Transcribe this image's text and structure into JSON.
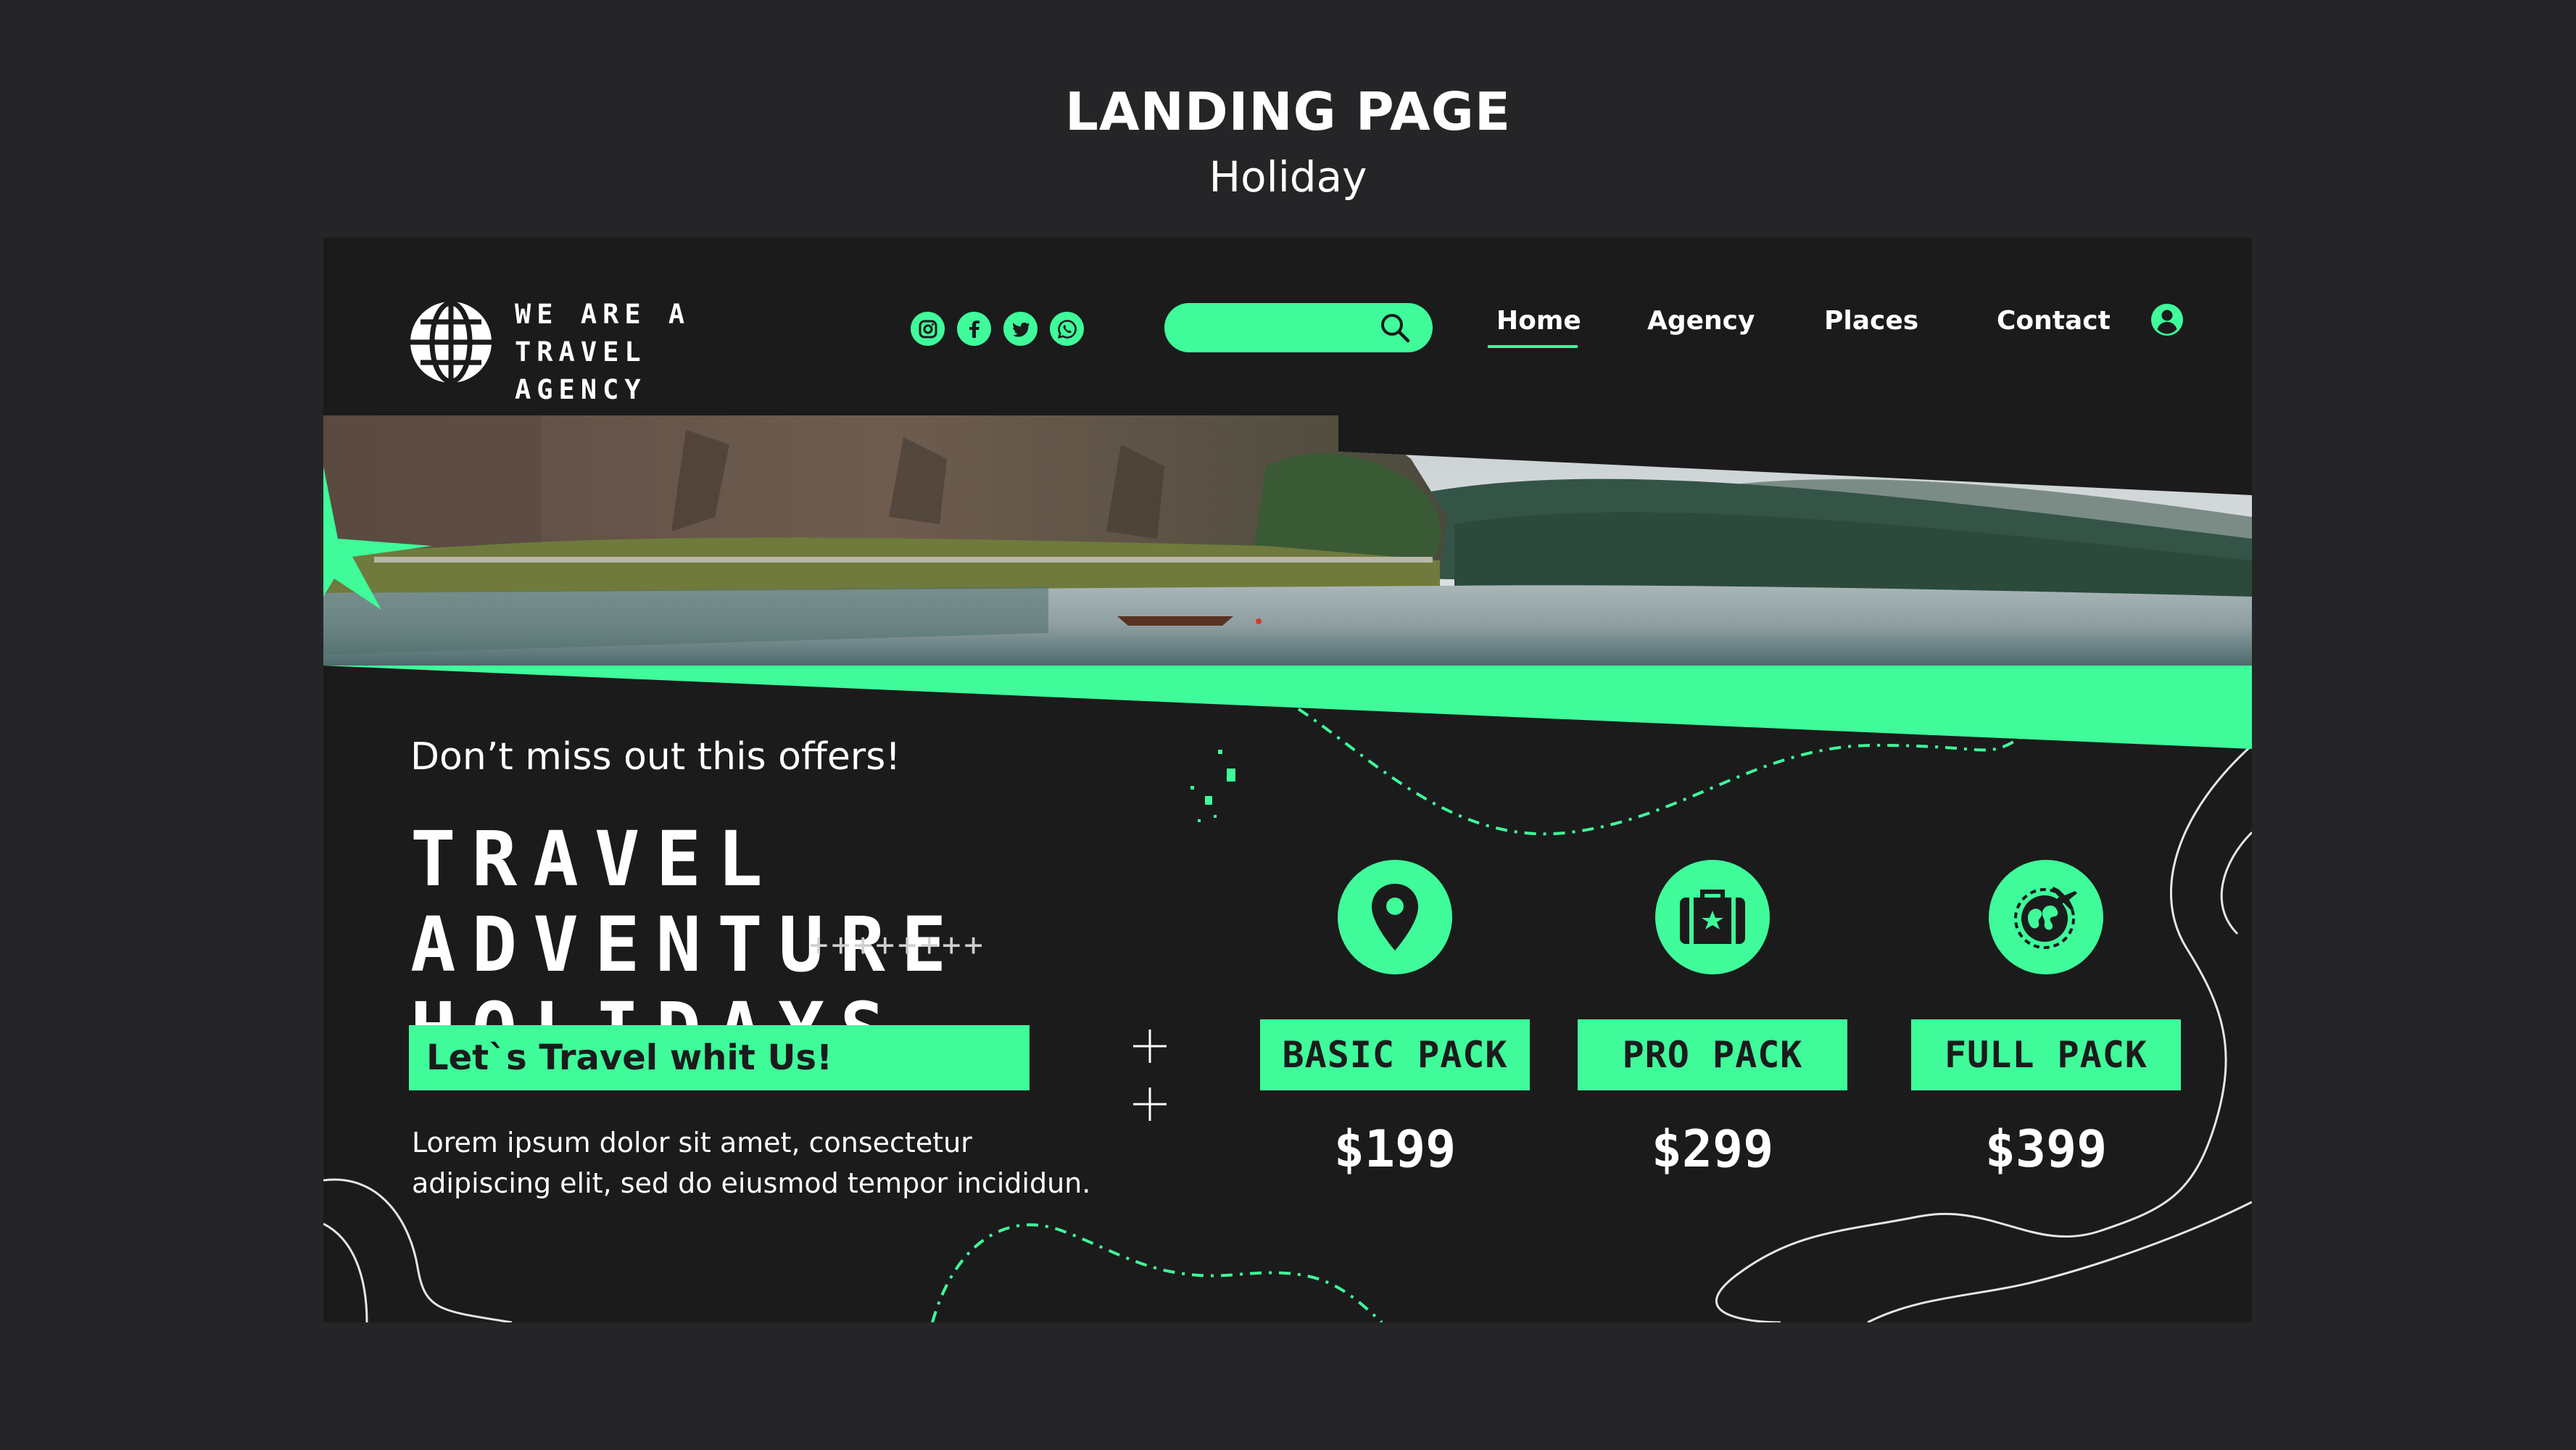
{
  "showcase": {
    "title": "LANDING PAGE",
    "subtitle": "Holiday"
  },
  "header": {
    "logo_icon": "globe-icon",
    "brand_line1": "WE ARE A TRAVEL",
    "brand_line2": "AGENCY",
    "socials": [
      "instagram-icon",
      "facebook-icon",
      "twitter-icon",
      "whatsapp-icon"
    ],
    "search": {
      "placeholder": "",
      "icon": "search-icon"
    },
    "nav": [
      {
        "label": "Home",
        "active": true
      },
      {
        "label": "Agency"
      },
      {
        "label": "Places"
      },
      {
        "label": "Contact"
      }
    ],
    "user_icon": "user-icon"
  },
  "hero": {
    "offer": "Don’t miss out this offers!",
    "headline_line1": "TRAVEL ADVENTURE",
    "headline_line2": "HOLIDAYS",
    "pluses": "++++++++",
    "cta": "Let`s Travel whit Us!",
    "description": "Lorem ipsum dolor sit amet, consectetur adipiscing elit, sed do eiusmod tempor incididun."
  },
  "packs": [
    {
      "icon": "location-pin-icon",
      "label": "BASIC PACK",
      "price": "$199"
    },
    {
      "icon": "suitcase-icon",
      "label": "PRO PACK",
      "price": "$299"
    },
    {
      "icon": "earth-plane-icon",
      "label": "FULL PACK",
      "price": "$399"
    }
  ],
  "colors": {
    "accent": "#3ffb9a",
    "background": "#252527",
    "panel": "#1b1b1c"
  }
}
